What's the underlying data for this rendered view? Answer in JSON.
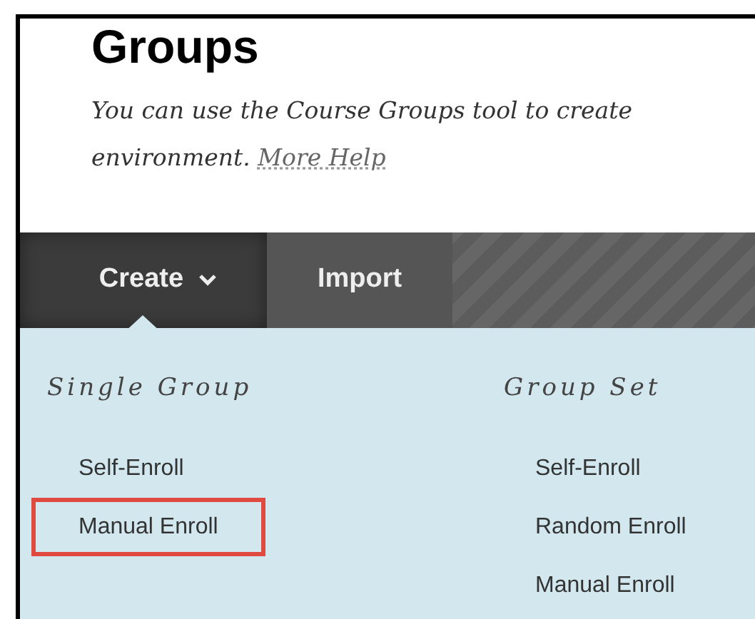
{
  "page": {
    "title": "Groups",
    "description": {
      "line_1": "You can use the Course Groups tool to create",
      "line_2": "environment.",
      "link": "More Help"
    }
  },
  "tabs": [
    {
      "label": "Create",
      "selected": true,
      "dropdown": true
    },
    {
      "label": "Import",
      "selected": false,
      "dropdown": false
    }
  ],
  "menu": {
    "columns": [
      {
        "heading": "Single Group",
        "items": [
          {
            "label": "Self-Enroll",
            "highlighted": false
          },
          {
            "label": "Manual Enroll",
            "highlighted": true
          }
        ]
      },
      {
        "heading": "Group Set",
        "items": [
          {
            "label": "Self-Enroll",
            "highlighted": false
          },
          {
            "label": "Random Enroll",
            "highlighted": false
          },
          {
            "label": "Manual Enroll",
            "highlighted": false
          }
        ]
      }
    ]
  }
}
